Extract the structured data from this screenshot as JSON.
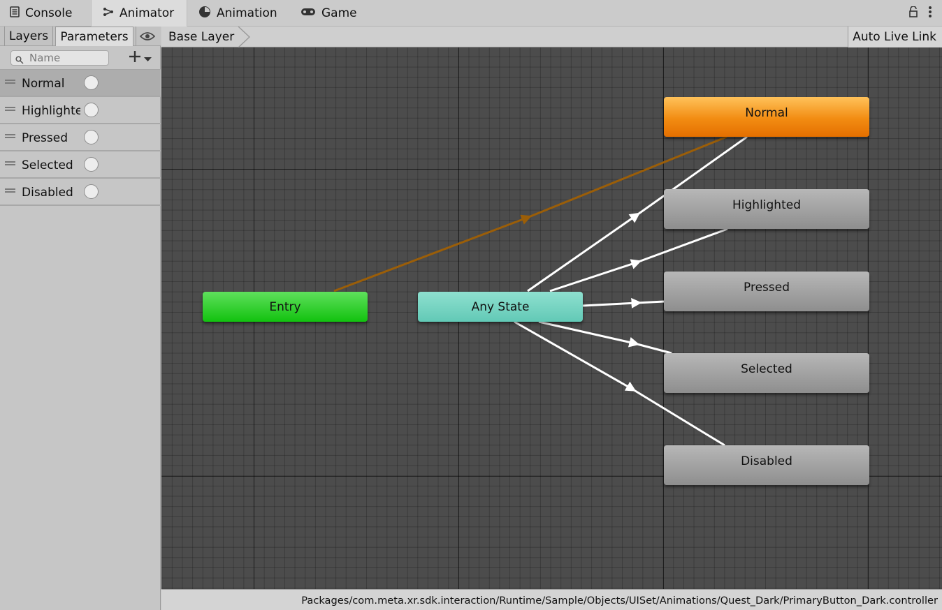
{
  "tabs": [
    {
      "label": "Console",
      "icon": "console-icon"
    },
    {
      "label": "Animator",
      "icon": "animator-icon"
    },
    {
      "label": "Animation",
      "icon": "animation-icon"
    },
    {
      "label": "Game",
      "icon": "gamepad-icon"
    }
  ],
  "active_tab": "Animator",
  "left_panel": {
    "tabs": {
      "layers": "Layers",
      "parameters": "Parameters"
    },
    "active_subtab": "Parameters",
    "search": {
      "placeholder": "Name",
      "value": ""
    },
    "parameters": [
      {
        "name": "Normal",
        "value": false,
        "selected": true
      },
      {
        "name": "Highlighted",
        "value": false,
        "selected": false
      },
      {
        "name": "Pressed",
        "value": false,
        "selected": false
      },
      {
        "name": "Selected",
        "value": false,
        "selected": false
      },
      {
        "name": "Disabled",
        "value": false,
        "selected": false
      }
    ]
  },
  "breadcrumb": {
    "layer": "Base Layer"
  },
  "toolbar": {
    "auto_live_link": "Auto Live Link"
  },
  "graph": {
    "entry": "Entry",
    "any_state": "Any State",
    "states": {
      "normal": "Normal",
      "highlighted": "Highlighted",
      "pressed": "Pressed",
      "selected": "Selected",
      "disabled": "Disabled"
    },
    "default_state": "Normal",
    "colors": {
      "entry": "#12c20f",
      "any_state": "#62c9b6",
      "default_state": "#f28c12",
      "state": "#9a9a9a",
      "default_transition": "#9b5e08",
      "transition": "#ffffff"
    }
  },
  "status": {
    "asset_path": "Packages/com.meta.xr.sdk.interaction/Runtime/Sample/Objects/UISet/Animations/Quest_Dark/PrimaryButton_Dark.controller"
  }
}
